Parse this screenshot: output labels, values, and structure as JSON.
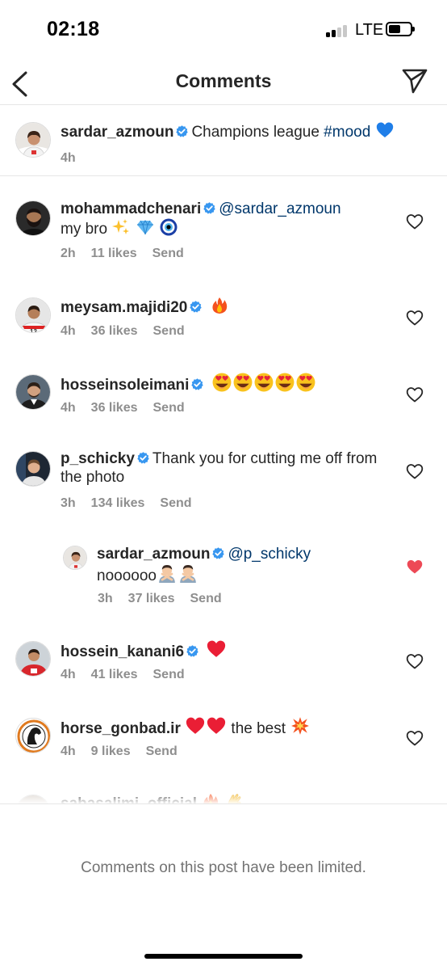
{
  "status_bar": {
    "time": "02:18",
    "network": "LTE"
  },
  "header": {
    "title": "Comments"
  },
  "caption": {
    "username": "sardar_azmoun",
    "text": "Champions league ",
    "hashtag": "#mood",
    "time": "4h"
  },
  "comments": [
    {
      "username": "mohammadchenari",
      "mention": "@sardar_azmoun",
      "text": "my bro",
      "time": "2h",
      "likes": "11 likes",
      "reply": "Send"
    },
    {
      "username": "meysam.majidi20",
      "time": "4h",
      "likes": "36 likes",
      "reply": "Send"
    },
    {
      "username": "hosseinsoleimani",
      "time": "4h",
      "likes": "36 likes",
      "reply": "Send"
    },
    {
      "username": "p_schicky",
      "text": "Thank you for cutting me off from the photo",
      "time": "3h",
      "likes": "134 likes",
      "reply": "Send"
    },
    {
      "username": "sardar_azmoun",
      "mention": "@p_schicky",
      "text": "noooooo",
      "time": "3h",
      "likes": "37 likes",
      "reply": "Send",
      "liked": true
    },
    {
      "username": "hossein_kanani6",
      "time": "4h",
      "likes": "41 likes",
      "reply": "Send"
    },
    {
      "username": "horse_gonbad.ir",
      "text": "the best",
      "time": "4h",
      "likes": "9 likes",
      "reply": "Send"
    },
    {
      "username": "sabasalimi_official"
    }
  ],
  "footer": {
    "note": "Comments on this post have been limited."
  },
  "colors": {
    "verified": "#3897f0",
    "link": "#00376b",
    "like_red": "#ed4956",
    "meta": "#8e8e8e"
  },
  "icons": [
    "back-chevron-icon",
    "direct-send-icon",
    "verified-badge-icon",
    "heart-outline-icon",
    "heart-filled-icon"
  ]
}
